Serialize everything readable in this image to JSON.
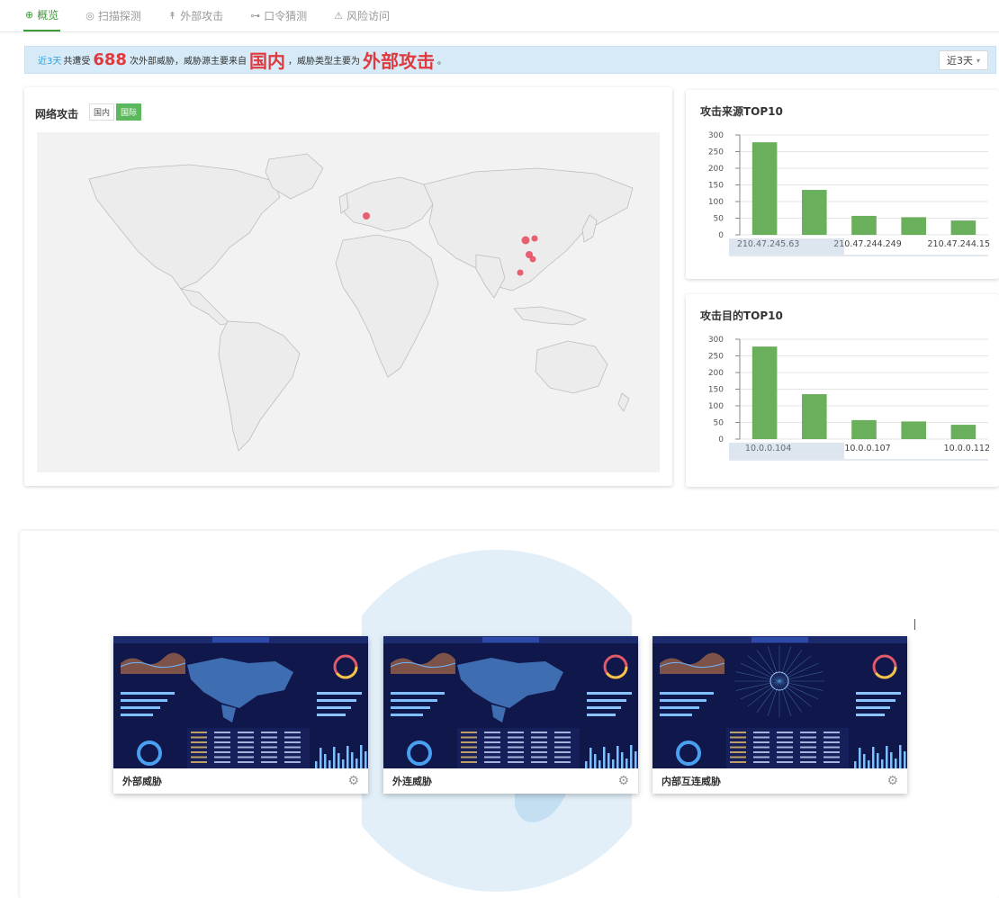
{
  "tabs": [
    {
      "label": "概览",
      "icon": "globe-icon",
      "glyph": "⊕",
      "active": true
    },
    {
      "label": "扫描探测",
      "icon": "scan-icon",
      "glyph": "◎",
      "active": false
    },
    {
      "label": "外部攻击",
      "icon": "attack-icon",
      "glyph": "↟",
      "active": false
    },
    {
      "label": "口令猜测",
      "icon": "key-icon",
      "glyph": "⊶",
      "active": false
    },
    {
      "label": "风险访问",
      "icon": "warning-icon",
      "glyph": "⚠",
      "active": false
    }
  ],
  "banner": {
    "period": "近3天",
    "prefix": "共遭受",
    "count": "688",
    "middle": "次外部威胁，威胁源主要来自",
    "source": "国内",
    "middle2": "，威胁类型主要为",
    "threat_type": "外部攻击",
    "suffix": "。",
    "period_select": "近3天"
  },
  "map_card": {
    "title": "网络攻击",
    "scope_domestic": "国内",
    "scope_international": "国际",
    "selected_scope": "国际"
  },
  "colors": {
    "accent": "#3d9c3a",
    "bar": "#6aaf5c",
    "alert": "#e0393e",
    "banner_bg": "#d6ebf7"
  },
  "source_chart": {
    "title": "攻击来源TOP10",
    "chart_data": {
      "type": "bar",
      "categories": [
        "210.47.245.63",
        "",
        "210.47.244.249",
        "",
        "210.47.244.15"
      ],
      "values": [
        278,
        135,
        57,
        53,
        43
      ],
      "ylim": [
        0,
        300
      ],
      "yticks": [
        0,
        50,
        100,
        150,
        200,
        250,
        300
      ],
      "grid": true
    }
  },
  "target_chart": {
    "title": "攻击目的TOP10",
    "chart_data": {
      "type": "bar",
      "categories": [
        "10.0.0.104",
        "",
        "10.0.0.107",
        "",
        "10.0.0.112"
      ],
      "values": [
        278,
        135,
        57,
        53,
        43
      ],
      "ylim": [
        0,
        300
      ],
      "yticks": [
        0,
        50,
        100,
        150,
        200,
        250,
        300
      ],
      "grid": true
    }
  },
  "dashboards": [
    {
      "label": "外部威胁",
      "variant": "map"
    },
    {
      "label": "外连威胁",
      "variant": "map"
    },
    {
      "label": "内部互连威胁",
      "variant": "network"
    }
  ]
}
